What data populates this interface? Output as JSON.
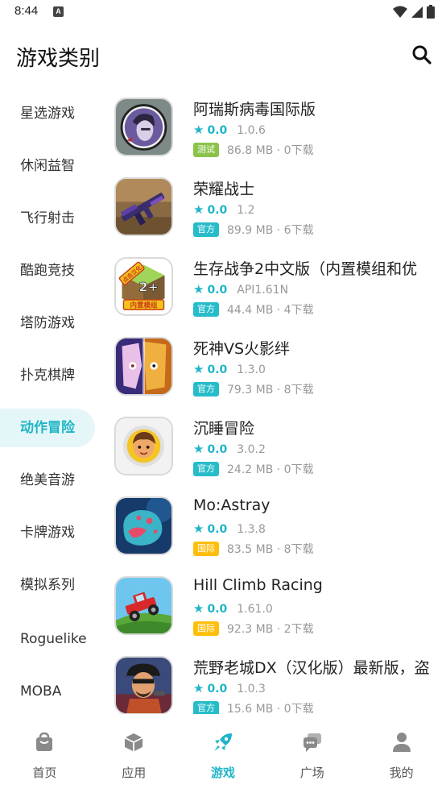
{
  "status_bar": {
    "time": "8:44",
    "notification": "A"
  },
  "header": {
    "title": "游戏类别"
  },
  "sidebar": {
    "items": [
      {
        "label": "星选游戏"
      },
      {
        "label": "休闲益智"
      },
      {
        "label": "飞行射击"
      },
      {
        "label": "酷跑竞技"
      },
      {
        "label": "塔防游戏"
      },
      {
        "label": "扑克棋牌"
      },
      {
        "label": "动作冒险",
        "active": true
      },
      {
        "label": "绝美音游"
      },
      {
        "label": "卡牌游戏"
      },
      {
        "label": "模拟系列"
      },
      {
        "label": "Roguelike"
      },
      {
        "label": "MOBA"
      }
    ]
  },
  "colors": {
    "accent": "#1fb5c6",
    "badge_test": "#8bc34a",
    "badge_official": "#26bcc9",
    "badge_intl": "#ffbe0b"
  },
  "games": [
    {
      "name": "阿瑞斯病毒国际版",
      "rating": "0.0",
      "version": "1.0.6",
      "badge": "测试",
      "badge_type": "test",
      "size_downloads": "86.8 MB · 0下载",
      "icon": "ares-virus-icon"
    },
    {
      "name": "荣耀战士",
      "rating": "0.0",
      "version": "1.2",
      "badge": "官方",
      "badge_type": "official",
      "size_downloads": "89.9 MB · 6下载",
      "icon": "glory-warrior-icon"
    },
    {
      "name": "生存战争2中文版（内置模组和优",
      "rating": "0.0",
      "version": "API1.61N",
      "badge": "官方",
      "badge_type": "official",
      "size_downloads": "44.4 MB · 4下载",
      "icon": "survivalcraft-icon",
      "icon_text_top": "点击汉化",
      "icon_text_mid": "2+",
      "icon_text_bottom": "内置模组"
    },
    {
      "name": "死神VS火影绊",
      "rating": "0.0",
      "version": "1.3.0",
      "badge": "官方",
      "badge_type": "official",
      "size_downloads": "79.3 MB · 8下载",
      "icon": "bleach-naruto-icon"
    },
    {
      "name": "沉睡冒险",
      "rating": "0.0",
      "version": "3.0.2",
      "badge": "官方",
      "badge_type": "official",
      "size_downloads": "24.2 MB · 0下载",
      "icon": "sleep-adventure-icon"
    },
    {
      "name": "Mo:Astray",
      "rating": "0.0",
      "version": "1.3.8",
      "badge": "国际",
      "badge_type": "intl",
      "size_downloads": "83.5 MB · 8下载",
      "icon": "mo-astray-icon"
    },
    {
      "name": "Hill Climb Racing",
      "rating": "0.0",
      "version": "1.61.0",
      "badge": "国际",
      "badge_type": "intl",
      "size_downloads": "92.3 MB · 2下载",
      "icon": "hill-climb-icon"
    },
    {
      "name": "荒野老城DX（汉化版）最新版，盗",
      "rating": "0.0",
      "version": "1.0.3",
      "badge": "官方",
      "badge_type": "official",
      "size_downloads": "15.6 MB · 0下载",
      "icon": "wild-town-icon"
    }
  ],
  "bottom_nav": {
    "tabs": [
      {
        "label": "首页",
        "icon": "home-bag-icon"
      },
      {
        "label": "应用",
        "icon": "app-cube-icon"
      },
      {
        "label": "游戏",
        "icon": "rocket-icon",
        "active": true
      },
      {
        "label": "广场",
        "icon": "chat-bubbles-icon"
      },
      {
        "label": "我的",
        "icon": "user-icon"
      }
    ]
  }
}
